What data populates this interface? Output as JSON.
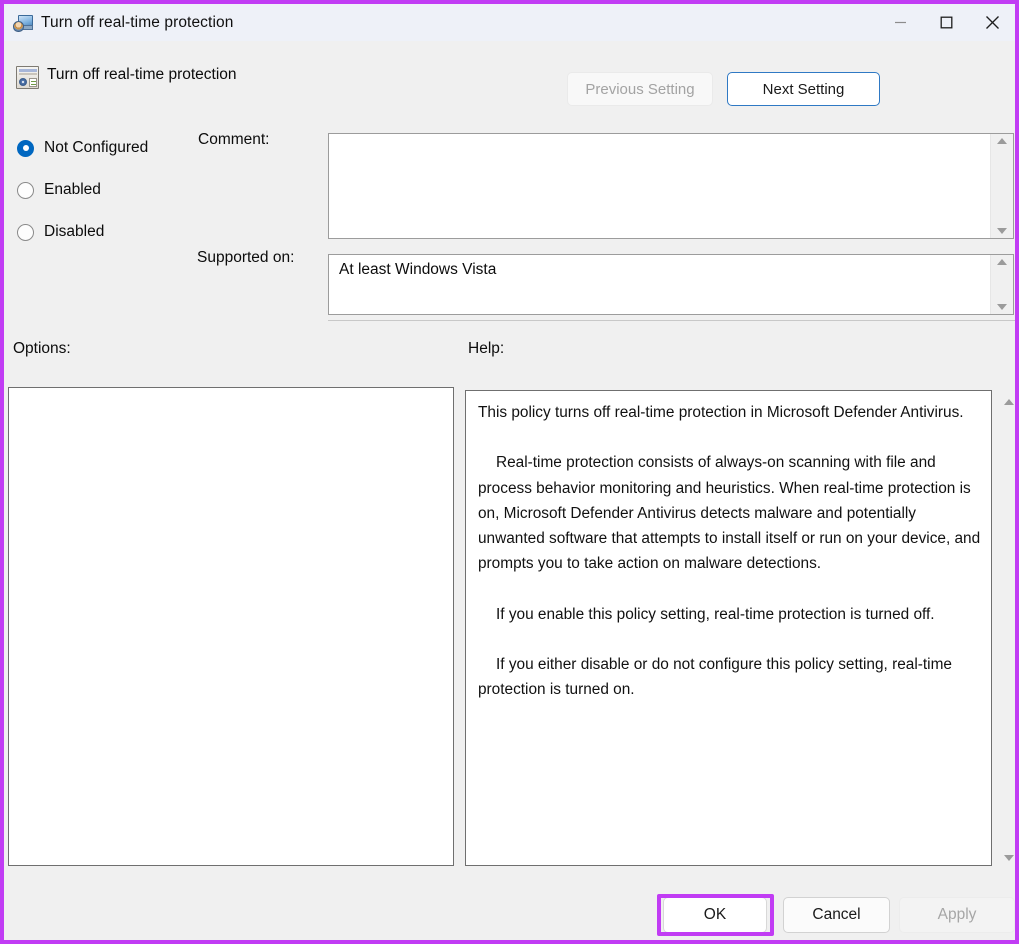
{
  "window": {
    "title": "Turn off real-time protection",
    "highlight_color": "#c13cf4",
    "accent_color": "#0067c0",
    "titlebar_background": "#eef1f8",
    "dialog_background": "#f0f0f0"
  },
  "titlebar_buttons": {
    "minimize": "Minimize",
    "maximize": "Maximize",
    "close": "Close"
  },
  "header": {
    "policy_title": "Turn off real-time protection",
    "previous_setting": "Previous Setting",
    "next_setting": "Next Setting"
  },
  "state_options": [
    {
      "label": "Not Configured",
      "selected": true
    },
    {
      "label": "Enabled",
      "selected": false
    },
    {
      "label": "Disabled",
      "selected": false
    }
  ],
  "fields": {
    "comment_label": "Comment:",
    "comment_value": "",
    "supported_on_label": "Supported on:",
    "supported_on_value": "At least Windows Vista"
  },
  "panes": {
    "options_label": "Options:",
    "options_content": "",
    "help_label": "Help:",
    "help_paragraphs": [
      "This policy turns off real-time protection in Microsoft Defender Antivirus.",
      "Real-time protection consists of always-on scanning with file and process behavior monitoring and heuristics. When real-time protection is on, Microsoft Defender Antivirus detects malware and potentially unwanted software that attempts to install itself or run on your device, and prompts you to take action on malware detections.",
      "If you enable this policy setting, real-time protection is turned off.",
      "If you either disable or do not configure this policy setting, real-time protection is turned on."
    ]
  },
  "footer": {
    "ok": "OK",
    "cancel": "Cancel",
    "apply": "Apply",
    "apply_disabled": true,
    "ok_highlighted": true
  }
}
